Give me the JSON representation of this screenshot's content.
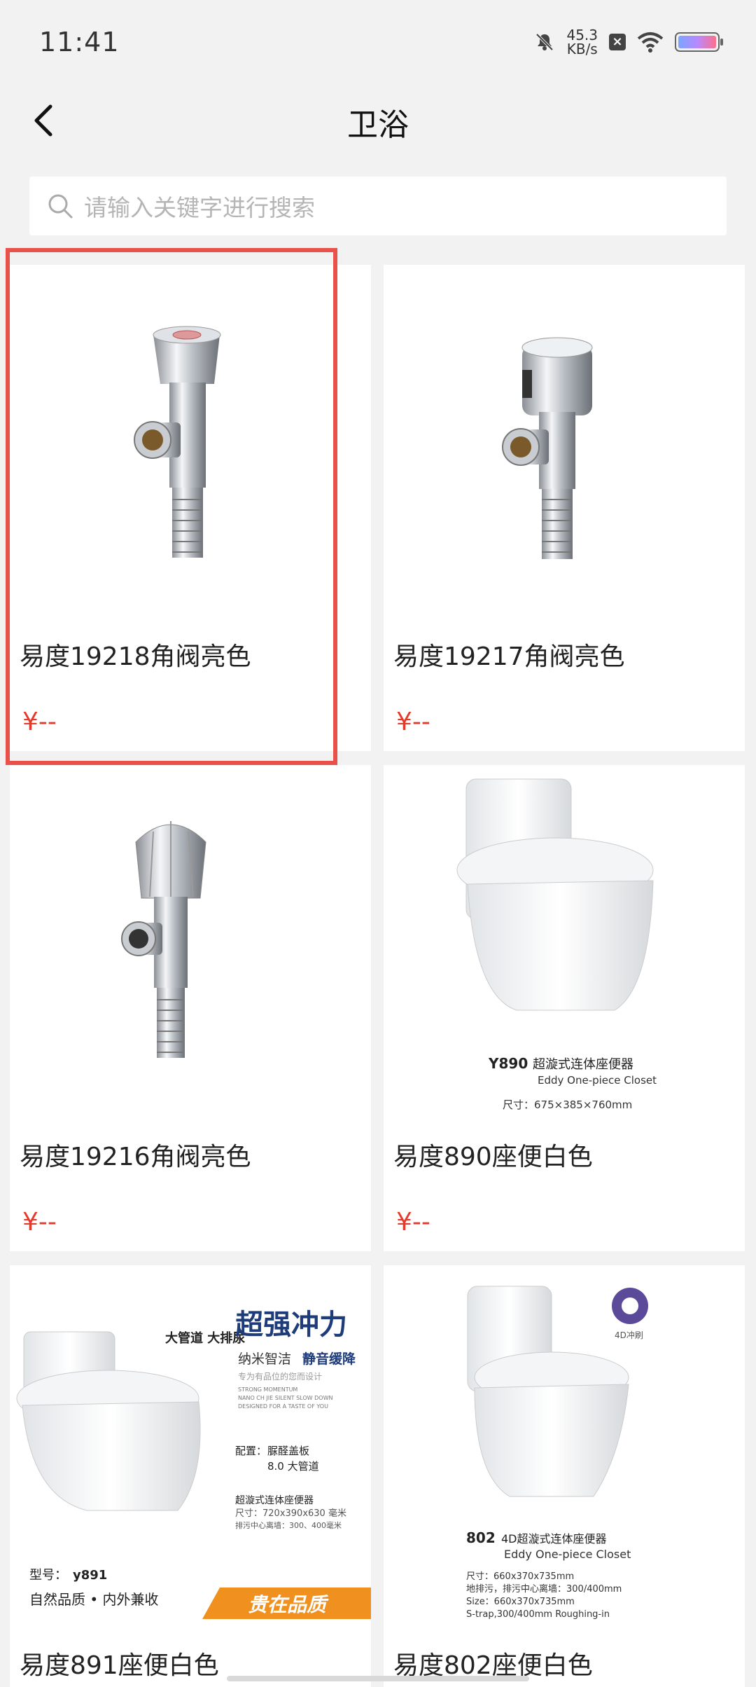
{
  "status": {
    "time": "11:41",
    "net_speed_value": "45.3",
    "net_speed_unit": "KB/s",
    "icons": [
      "mute-bell-icon",
      "close-box-icon",
      "wifi-icon",
      "battery-icon"
    ]
  },
  "nav": {
    "title": "卫浴",
    "back_icon": "chevron-left-icon"
  },
  "search": {
    "placeholder": "请输入关键字进行搜索",
    "icon": "search-icon"
  },
  "products": [
    {
      "name": "易度19218角阀亮色",
      "price": "¥--",
      "image": "angle-valve-chrome"
    },
    {
      "name": "易度19217角阀亮色",
      "price": "¥--",
      "image": "angle-valve-chrome"
    },
    {
      "name": "易度19216角阀亮色",
      "price": "¥--",
      "image": "angle-valve-chrome"
    },
    {
      "name": "易度890座便白色",
      "price": "¥--",
      "image": "toilet-white",
      "image_text": {
        "model": "Y890",
        "title": "超漩式连体座便器",
        "subtitle": "Eddy One-piece Closet",
        "size": "尺寸：675×385×760mm"
      }
    },
    {
      "name": "易度891座便白色",
      "price": "¥--",
      "image": "toilet-white",
      "image_text": {
        "headline": "超强冲力",
        "tag1": "纳米智洁",
        "tag2": "静音缓降",
        "slogan": "专为有品位的您而设计",
        "en1": "STRONG MOMENTUM",
        "en2": "NANO CH JIE   SILENT SLOW DOWN",
        "en3": "DESIGNED FOR A TASTE OF YOU",
        "config_label": "配置：",
        "config1": "脲醛盖板",
        "config2": "8.0 大管道",
        "type": "超漩式连体座便器",
        "size": "尺寸：720x390x630 毫米",
        "pitch": "排污中心离墙：300、400毫米",
        "model_label": "型号：",
        "model": "y891",
        "quality": "自然品质 • 内外兼收",
        "banner": "贵在品质",
        "sticker": "大管道 大排尿"
      }
    },
    {
      "name": "易度802座便白色",
      "price": "",
      "image": "toilet-white",
      "image_text": {
        "badge": "4D冲刷",
        "model": "802",
        "title": "4D超漩式连体座便器",
        "subtitle": "Eddy One-piece Closet",
        "line1": "尺寸：660x370x735mm",
        "line2": "地排污，排污中心离墙：300/400mm",
        "line3": "Size：660x370x735mm",
        "line4": "S-trap,300/400mm Roughing-in"
      }
    }
  ],
  "colors": {
    "price": "#e53a2b",
    "highlight": "#e8524a",
    "background": "#f2f2f2"
  }
}
